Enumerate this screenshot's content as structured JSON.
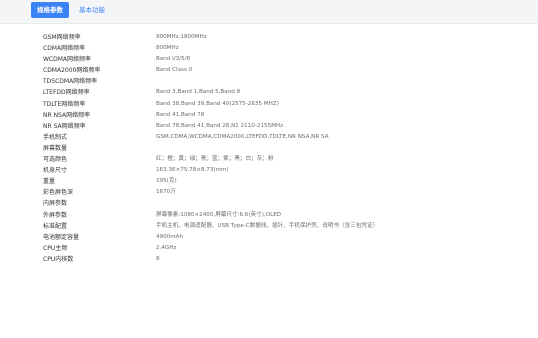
{
  "tabs": {
    "active": "规格参数",
    "inactive": "基本功能"
  },
  "specs": [
    {
      "label": "GSM网络频率",
      "value": "900MHz,1800MHz"
    },
    {
      "label": "CDMA网络频率",
      "value": "800MHz"
    },
    {
      "label": "WCDMA网络频率",
      "value": "Band Ⅰ/3/5/8"
    },
    {
      "label": "CDMA2000网络频率",
      "value": "Band Class 0"
    },
    {
      "label": "TDSCDMA网络频率",
      "value": ""
    },
    {
      "label": "LTEFDD网络频率",
      "value": "Band 3,Band 1,Band 5,Band 8"
    },
    {
      "label": "TDLTE网络频率",
      "value": "Band 38,Band 39,Band 40(2575-2635 MHZ)"
    },
    {
      "label": "NR NSA网络频率",
      "value": "Band 41,Band 78"
    },
    {
      "label": "NR SA网络频率",
      "value": "Band 78,Band 41,Band 28,N1 2110-2155MHz"
    },
    {
      "label": "手机制式",
      "value": "GSM,CDMA,WCDMA,CDMA2000,LTEFDD,TDLTE,NR NSA,NR SA"
    },
    {
      "label": "屏幕数量",
      "value": ""
    },
    {
      "label": "可选颜色",
      "value": "红；橙；黄；绿；青；蓝；紫；黑；白；灰；粉"
    },
    {
      "label": "机身尺寸",
      "value": "163.36×75.78×8.73(mm)"
    },
    {
      "label": "重量",
      "value": "195(克)"
    },
    {
      "label": "彩色屏色深",
      "value": "1670万"
    },
    {
      "label": "内屏参数",
      "value": ""
    },
    {
      "label": "外屏参数",
      "value": "屏幕像素:1080×2400,屏幕尺寸:6.6(英寸),OLED"
    },
    {
      "label": "标准配置",
      "value": "手机主机、电源适配器、USB Type-C数据线、插针、手机保护壳、说明书（含三包凭证）"
    },
    {
      "label": "电池额定容量",
      "value": "4900mAh"
    },
    {
      "label": "CPU主频",
      "value": "2.4GHz"
    },
    {
      "label": "CPU内核数",
      "value": "8"
    }
  ]
}
